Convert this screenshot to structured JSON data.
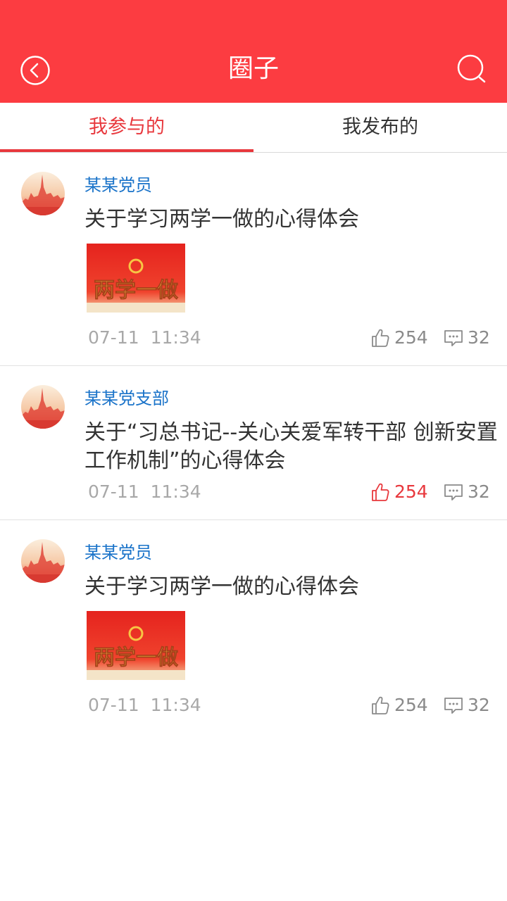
{
  "header": {
    "title": "圈子",
    "back_icon": "chevron-left-circle-icon",
    "search_icon": "search-icon",
    "background": "#fc3c41"
  },
  "tabs": [
    {
      "label": "我参与的",
      "active": true
    },
    {
      "label": "我发布的",
      "active": false
    }
  ],
  "colors": {
    "accent": "#e8383d",
    "author": "#1a73c9",
    "muted": "#a8a8a8"
  },
  "posts": [
    {
      "author": "某某党员",
      "title": "关于学习两学一做的心得体会",
      "has_image": true,
      "image_text": "两学一做",
      "time": "07-11  11:34",
      "likes": "254",
      "liked": false,
      "comments": "32"
    },
    {
      "author": "某某党支部",
      "title": "关于“习总书记--关心关爱军转干部 创新安置工作机制”的心得体会",
      "has_image": false,
      "time": "07-11  11:34",
      "likes": "254",
      "liked": true,
      "comments": "32"
    },
    {
      "author": "某某党员",
      "title": "关于学习两学一做的心得体会",
      "has_image": true,
      "image_text": "两学一做",
      "time": "07-11  11:34",
      "likes": "254",
      "liked": false,
      "comments": "32"
    }
  ]
}
